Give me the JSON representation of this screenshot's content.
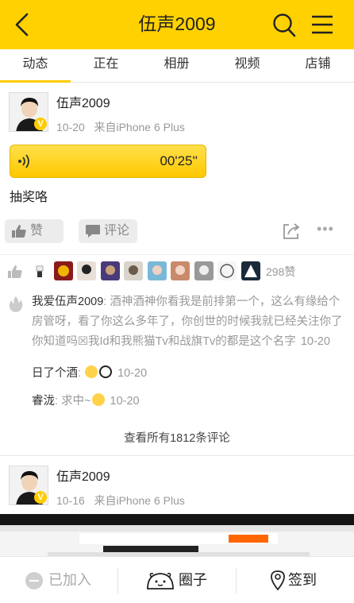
{
  "header": {
    "title": "伍声2009",
    "back_icon": "back-arrow-icon",
    "search_icon": "search-icon",
    "menu_icon": "menu-icon",
    "bg": "#ffd100"
  },
  "tabs": [
    {
      "label": "动态",
      "active": true
    },
    {
      "label": "正在"
    },
    {
      "label": "相册"
    },
    {
      "label": "视频"
    },
    {
      "label": "店铺"
    }
  ],
  "post1": {
    "author": "伍声2009",
    "time": "10-20",
    "source": "来自iPhone 6 Plus",
    "voice_duration": "00'25''",
    "text": "抽奖咯",
    "like_label": "赞",
    "comment_label": "评论",
    "more": "•••",
    "like_count": "298赞",
    "comments": [
      {
        "who": "我爱伍声2009",
        "sep": ": ",
        "body": "酒神酒神你看我是前排第一个，这么有缘给个房管呀，看了你这么多年了，你创世的时候我就已经关注你了你知道吗☒我Id和我熊猫Tv和战旗Tv的都是这个名字",
        "time": "10-20"
      },
      {
        "who": "日了个酒",
        "sep": ": ",
        "body": "",
        "time": "10-20"
      },
      {
        "who": "睿泷",
        "sep": ": ",
        "body": "求中~",
        "time": "10-20"
      }
    ],
    "view_all": "查看所有1812条评论"
  },
  "post2": {
    "author": "伍声2009",
    "time": "10-16",
    "source": "来自iPhone 6 Plus"
  },
  "bottom": {
    "joined": "已加入",
    "circle": "圈子",
    "checkin": "签到"
  }
}
